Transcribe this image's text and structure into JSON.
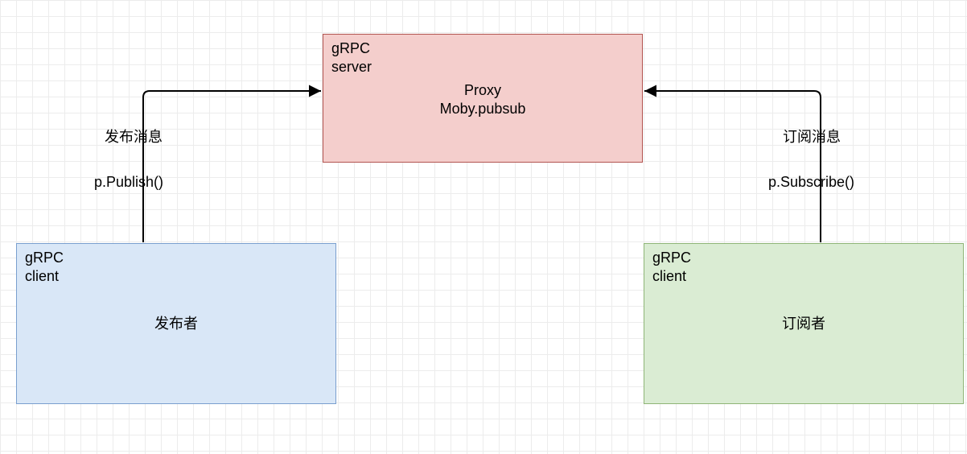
{
  "diagram": {
    "server": {
      "role_line1": "gRPC",
      "role_line2": "server",
      "title_line1": "Proxy",
      "title_line2": "Moby.pubsub"
    },
    "publisher": {
      "role_line1": "gRPC",
      "role_line2": "client",
      "title": "发布者",
      "edge_action": "发布消息",
      "edge_method": "p.Publish()"
    },
    "subscriber": {
      "role_line1": "gRPC",
      "role_line2": "client",
      "title": "订阅者",
      "edge_action": "订阅消息",
      "edge_method": "p.Subscribe()"
    }
  }
}
